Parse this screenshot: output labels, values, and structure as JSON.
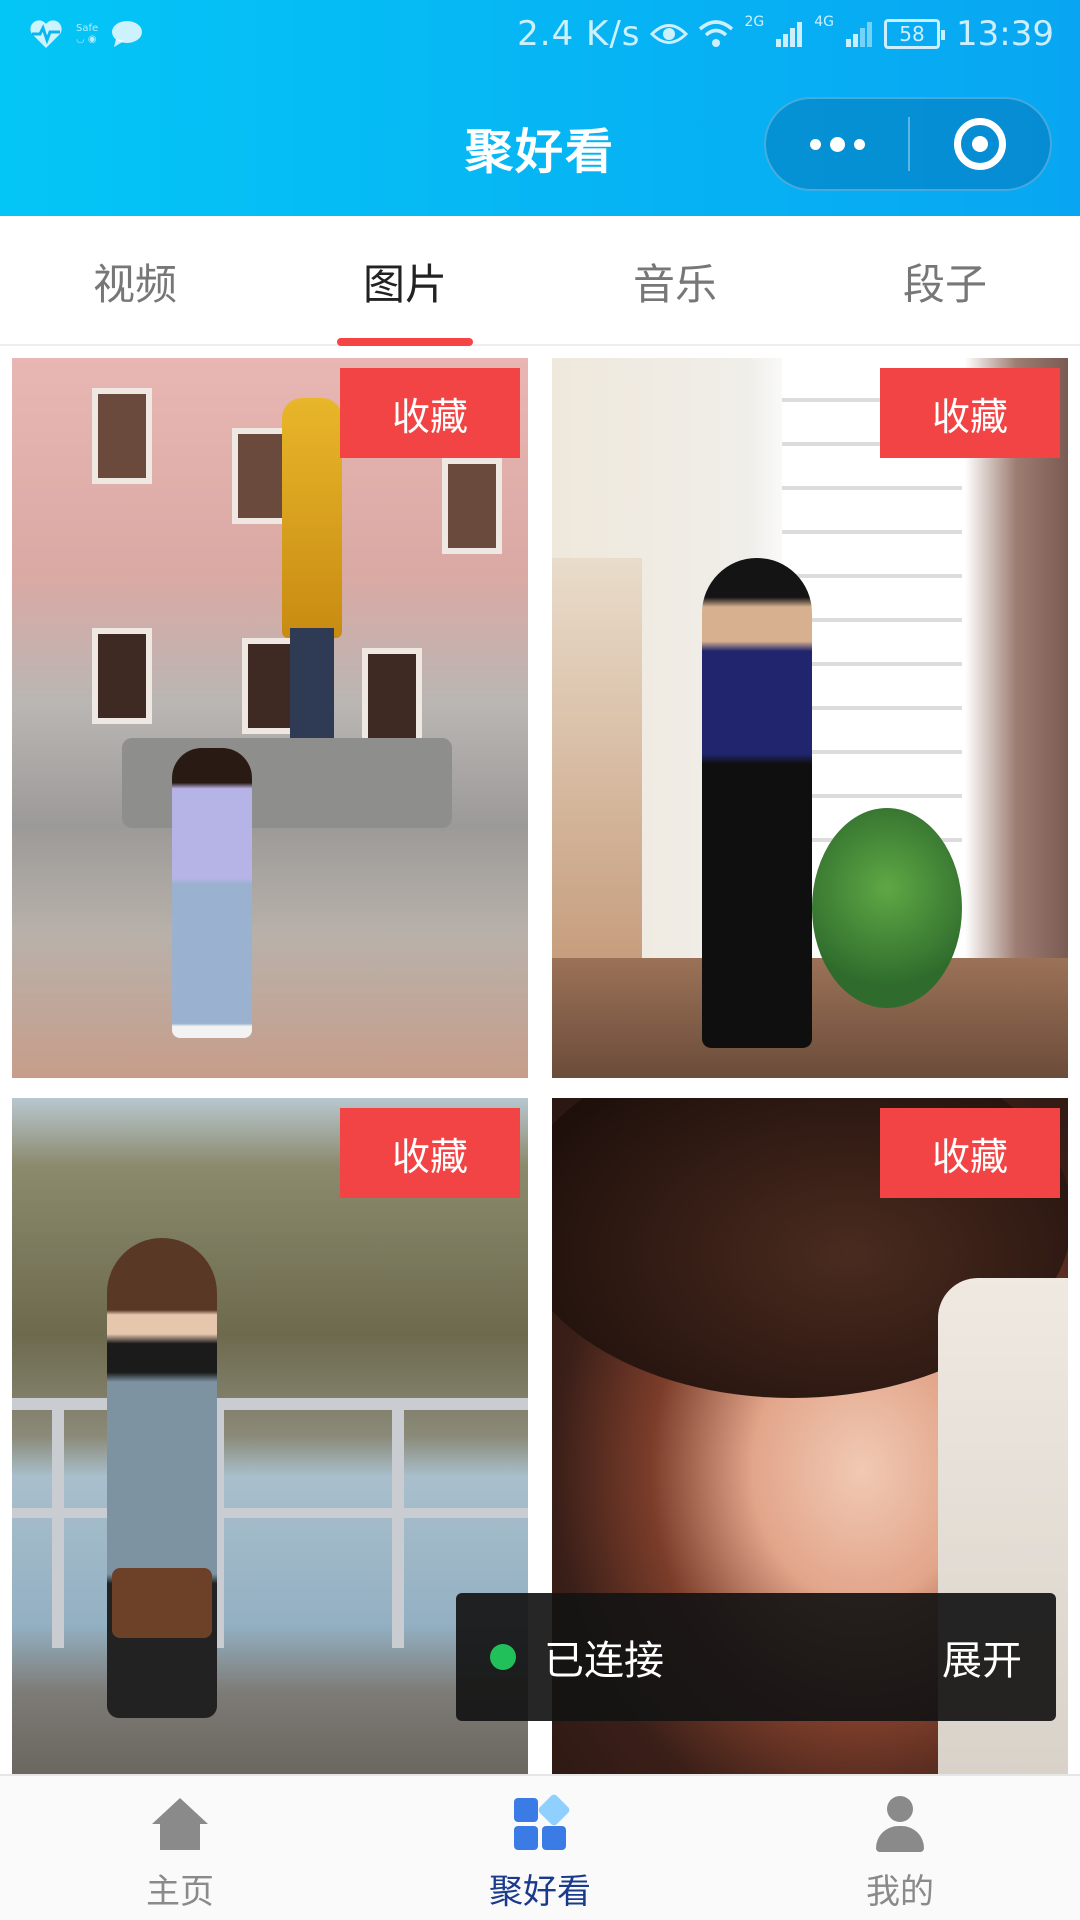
{
  "status_bar": {
    "left_icons": [
      "heartbeat-icon",
      "safe-icon",
      "chat-bubble-icon"
    ],
    "safe_text": "Safe",
    "speed": "2.4 K/s",
    "network_2g": "2G",
    "network_4g": "4G",
    "battery": "58",
    "time": "13:39"
  },
  "header": {
    "title": "聚好看",
    "colors": {
      "gradient_start": "#04c6f6",
      "gradient_end": "#08a6f2"
    }
  },
  "tabs": {
    "items": [
      {
        "label": "视频",
        "active": false
      },
      {
        "label": "图片",
        "active": true
      },
      {
        "label": "音乐",
        "active": false
      },
      {
        "label": "段子",
        "active": false
      }
    ],
    "accent_color": "#f44444"
  },
  "grid": {
    "cards": [
      {
        "favorite_label": "收藏",
        "image": "woman-sitting-by-fountain"
      },
      {
        "favorite_label": "收藏",
        "image": "woman-in-hat-by-white-wall"
      },
      {
        "favorite_label": "收藏",
        "image": "woman-by-lake-railing"
      },
      {
        "favorite_label": "收藏",
        "image": "woman-close-up-portrait"
      }
    ]
  },
  "toast": {
    "status": "已连接",
    "action": "展开",
    "status_color": "#22c05a"
  },
  "tabbar": {
    "items": [
      {
        "label": "主页",
        "icon": "home-icon",
        "active": false
      },
      {
        "label": "聚好看",
        "icon": "grid-icon",
        "active": true
      },
      {
        "label": "我的",
        "icon": "profile-icon",
        "active": false
      }
    ]
  }
}
